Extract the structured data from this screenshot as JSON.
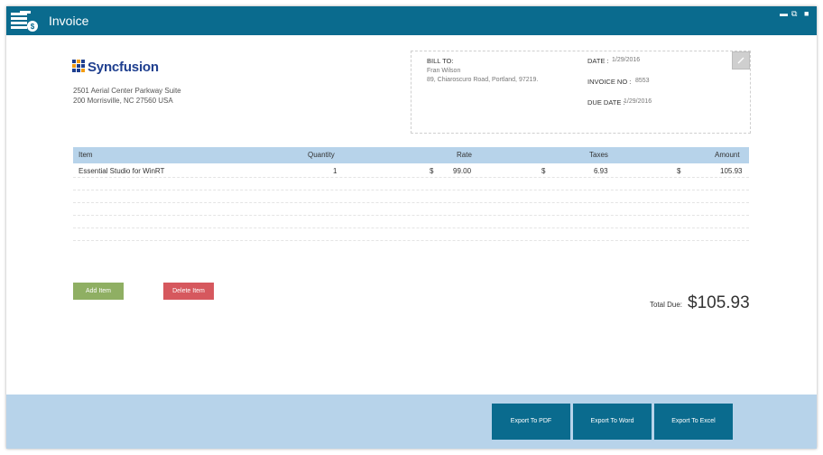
{
  "window": {
    "title": "Invoice",
    "controls": [
      "minimize-icon",
      "restore-icon",
      "close-icon"
    ]
  },
  "company": {
    "logo_text": "Syncfusion",
    "address_line1": "2501 Aerial Center Parkway Suite",
    "address_line2": "200 Morrisville, NC 27560 USA"
  },
  "bill": {
    "bill_to_label": "BILL TO:",
    "name": "Fran Wilson",
    "address": "89, Chiaroscuro Road, Portland, 97219.",
    "date_label": "DATE :",
    "date": "1/29/2016",
    "invoice_no_label": "INVOICE NO :",
    "invoice_no": "8553",
    "due_date_label": "DUE DATE :",
    "due_date": "1/29/2016"
  },
  "table": {
    "headers": {
      "item": "Item",
      "quantity": "Quantity",
      "rate": "Rate",
      "taxes": "Taxes",
      "amount": "Amount"
    },
    "rows": [
      {
        "item": "Essential Studio for WinRT",
        "quantity": "1",
        "rate_currency": "$",
        "rate": "99.00",
        "taxes_currency": "$",
        "taxes": "6.93",
        "amount_currency": "$",
        "amount": "105.93"
      }
    ]
  },
  "actions": {
    "add_item": "Add Item",
    "delete_item": "Delete Item"
  },
  "total": {
    "label": "Total Due:",
    "value": "$105.93"
  },
  "footer": {
    "export_pdf": "Export To PDF",
    "export_word": "Export To Word",
    "export_excel": "Export To Excel"
  },
  "colors": {
    "titlebar": "#0a6b8e",
    "table_header": "#b7d3ea",
    "add_button": "#8faf63",
    "delete_button": "#d6585e",
    "footer": "#b7d3ea"
  }
}
